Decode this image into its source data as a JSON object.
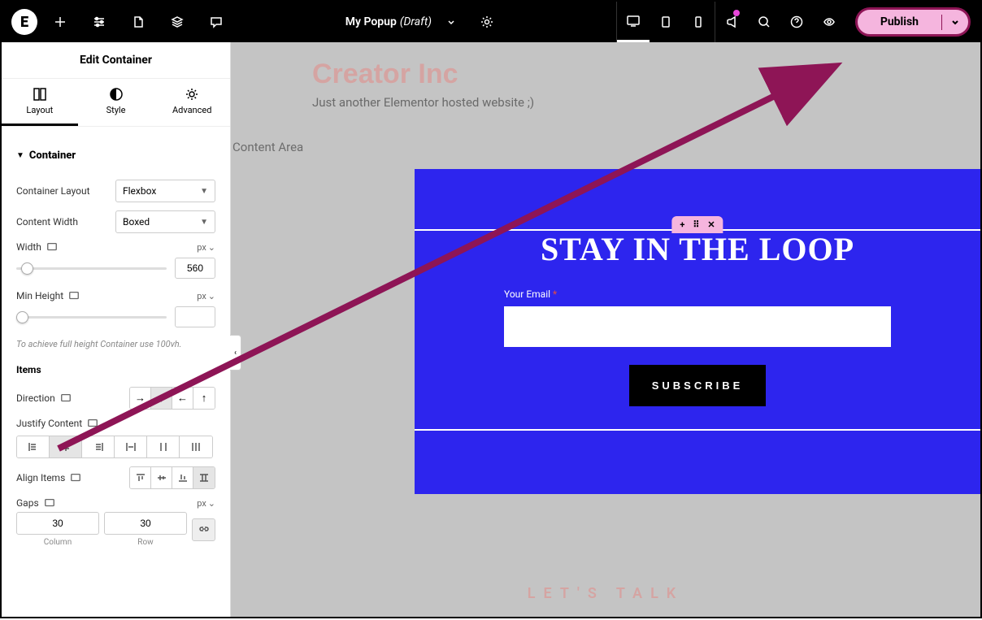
{
  "topbar": {
    "doc_title": "My Popup",
    "doc_status": "(Draft)",
    "publish_label": "Publish"
  },
  "sidebar": {
    "header": "Edit Container",
    "tabs": {
      "layout": "Layout",
      "style": "Style",
      "advanced": "Advanced"
    },
    "section_container": "Container",
    "container_layout_label": "Container Layout",
    "container_layout_value": "Flexbox",
    "content_width_label": "Content Width",
    "content_width_value": "Boxed",
    "width_label": "Width",
    "width_unit": "px",
    "width_value": "560",
    "min_height_label": "Min Height",
    "min_height_unit": "px",
    "hint": "To achieve full height Container use 100vh.",
    "items_head": "Items",
    "direction_label": "Direction",
    "justify_label": "Justify Content",
    "align_label": "Align Items",
    "gaps_label": "Gaps",
    "gaps_unit": "px",
    "gap_col_value": "30",
    "gap_row_value": "30",
    "gap_col_label": "Column",
    "gap_row_label": "Row"
  },
  "canvas": {
    "content_area_label": "Content Area",
    "site_title": "Creator Inc",
    "site_tagline": "Just another Elementor hosted website ;)",
    "popup_title": "STAY IN THE LOOP",
    "form_label": "Your Email",
    "form_required": "*",
    "subscribe": "SUBSCRIBE",
    "lets_talk": "LET'S  TALK"
  },
  "colors": {
    "annotation": "#8e1556",
    "popup_bg": "#2d25ee",
    "publish_bg": "#f5b5de",
    "site_accent": "#e18f8d"
  }
}
